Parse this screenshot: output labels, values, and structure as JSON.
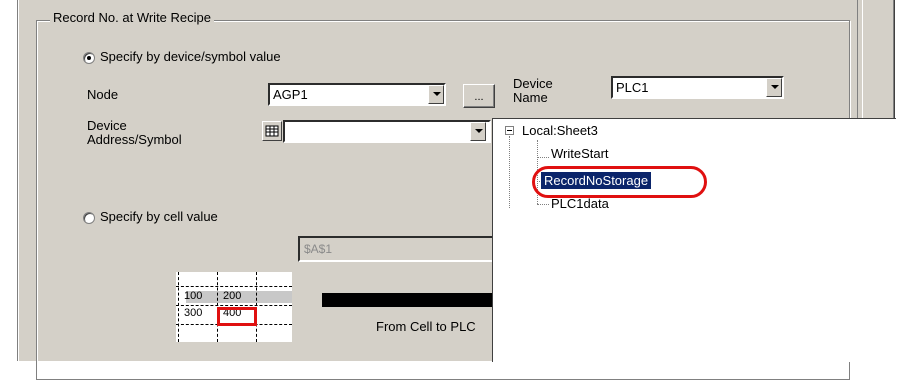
{
  "group": {
    "title": "Record No. at Write Recipe"
  },
  "device_option": {
    "label": "Specify by device/symbol value",
    "selected": true,
    "node_label": "Node",
    "node_value": "AGP1",
    "browse_label": "...",
    "device_name_label_line1": "Device",
    "device_name_label_line2": "Name",
    "device_name_value": "PLC1",
    "address_label_line1": "Device",
    "address_label_line2": "Address/Symbol",
    "address_value": ""
  },
  "cell_option": {
    "label": "Specify by cell value",
    "selected": false,
    "cell_value": "$A$1"
  },
  "tree": {
    "root": "Local:Sheet3",
    "items": [
      "WriteStart",
      "RecordNoStorage",
      "PLC1data"
    ],
    "selected": "RecordNoStorage"
  },
  "mini_grid": {
    "rows": [
      [
        "100",
        "200"
      ],
      [
        "300",
        "400"
      ]
    ]
  },
  "caption": "From Cell to PLC",
  "colors": {
    "selection": "#0a246a",
    "highlight": "#e01010",
    "face": "#d4d0c8"
  }
}
